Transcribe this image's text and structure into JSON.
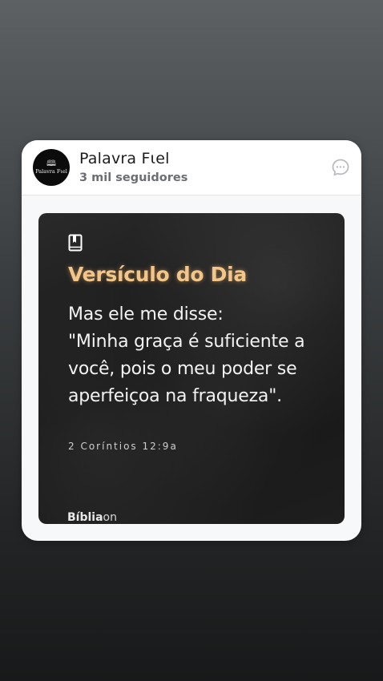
{
  "profile": {
    "name": "Palavra Fιel",
    "followers": "3 mil seguidores",
    "avatar_text": "Palavra Fιel"
  },
  "post": {
    "title": "Versículo do Dia",
    "verse": "Mas ele me disse:\n\"Minha graça é suficiente a você, pois o meu poder se aperfeiçoa na fraqueza\".",
    "reference": "2 Coríntios 12:9a",
    "brand_bold": "Bíblia",
    "brand_light": "on"
  },
  "icons": {
    "avatar": "open-book-icon",
    "chat": "chat-bubble-icon",
    "bible": "bookmark-book-icon"
  },
  "colors": {
    "title": "#f2c58a",
    "verse_text": "#f3f3f3",
    "card": "#f7f8f9"
  }
}
